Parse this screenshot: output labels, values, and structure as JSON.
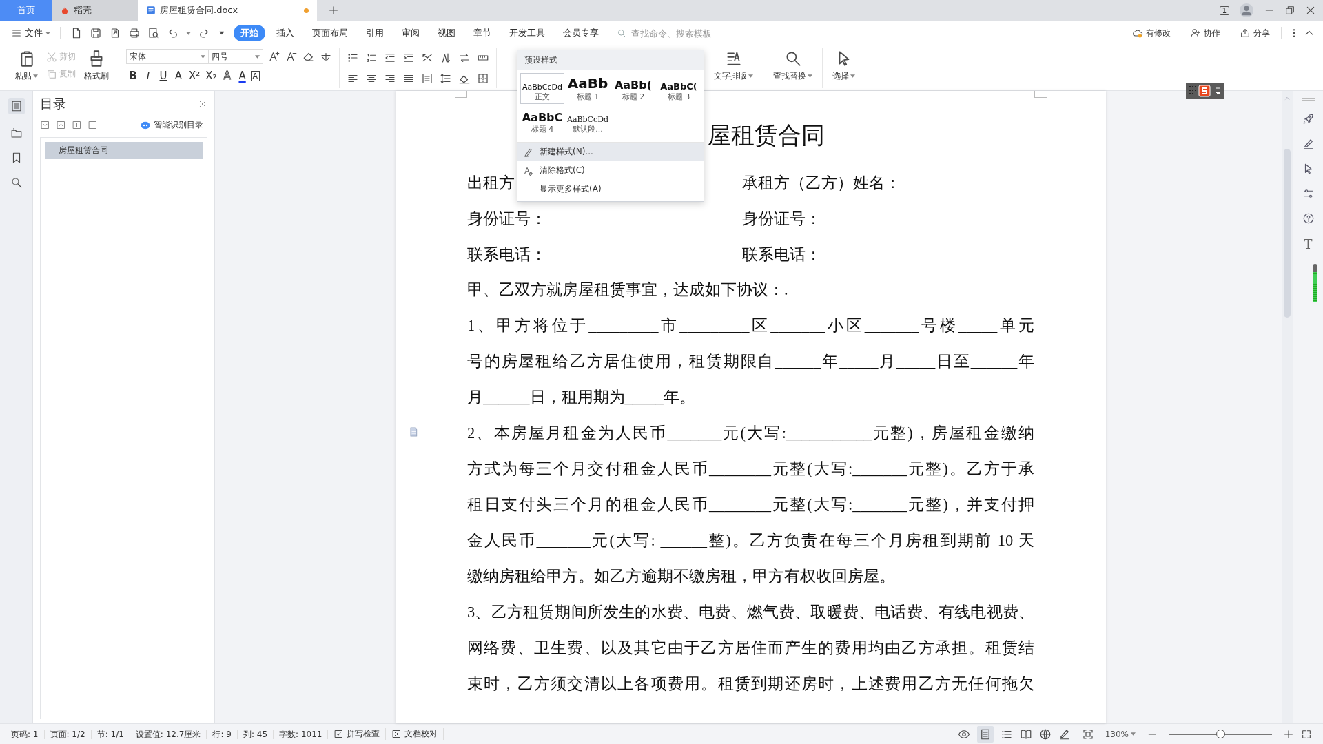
{
  "title_bar": {
    "tabs": [
      {
        "label": "首页",
        "kind": "home",
        "selected": false,
        "modified": false
      },
      {
        "label": "稻壳",
        "kind": "app",
        "selected": false,
        "modified": false
      },
      {
        "label": "房屋租赁合同.docx",
        "kind": "doc",
        "selected": true,
        "modified": true
      }
    ],
    "window_count": "1"
  },
  "menu_bar": {
    "file": "文件",
    "tabs": [
      {
        "label": "开始",
        "selected": true
      },
      {
        "label": "插入",
        "selected": false
      },
      {
        "label": "页面布局",
        "selected": false
      },
      {
        "label": "引用",
        "selected": false
      },
      {
        "label": "审阅",
        "selected": false
      },
      {
        "label": "视图",
        "selected": false
      },
      {
        "label": "章节",
        "selected": false
      },
      {
        "label": "开发工具",
        "selected": false
      },
      {
        "label": "会员专享",
        "selected": false
      }
    ],
    "search": {
      "placeholder": "查找命令、搜索模板"
    },
    "actions": [
      "有修改",
      "协作",
      "分享"
    ]
  },
  "ribbon": {
    "paste": "粘贴",
    "cut": {
      "label": "剪切",
      "disabled": true
    },
    "copy": {
      "label": "复制",
      "disabled": true
    },
    "format_painter": "格式刷",
    "font": {
      "value": "宋体"
    },
    "font_size": {
      "value": "四号"
    },
    "format_buttons": [
      {
        "label": "B",
        "kind": "bold"
      },
      {
        "label": "I",
        "kind": "italic"
      },
      {
        "label": "U",
        "kind": "underline"
      },
      {
        "label": "A",
        "kind": "strike"
      },
      {
        "label": "X²",
        "kind": "plain"
      },
      {
        "label": "X₂",
        "kind": "plain"
      },
      {
        "label": "A",
        "kind": "outline"
      },
      {
        "label": "A",
        "kind": "color"
      },
      {
        "label": "A",
        "kind": "boxed"
      }
    ],
    "tools": [
      "文字排版",
      "查找替换",
      "选择"
    ]
  },
  "styles_menu": {
    "header": "预设样式",
    "styles": [
      {
        "sample": "AaBbCcDd",
        "label": "正文",
        "kind": "body",
        "selected": true
      },
      {
        "sample": "AaBb",
        "label": "标题 1",
        "kind": "h1",
        "selected": false
      },
      {
        "sample": "AaBb(",
        "label": "标题 2",
        "kind": "h2",
        "selected": false
      },
      {
        "sample": "AaBbC(",
        "label": "标题 3",
        "kind": "h3",
        "selected": false
      },
      {
        "sample": "AaBbC",
        "label": "标题 4",
        "kind": "h4",
        "selected": false
      },
      {
        "sample": "AaBbCcDd",
        "label": "默认段...",
        "kind": "default",
        "selected": false
      }
    ],
    "items": [
      {
        "label": "新建样式(N)...",
        "selected": true
      },
      {
        "label": "清除格式(C)",
        "selected": false
      },
      {
        "label": "显示更多样式(A)",
        "selected": false
      }
    ]
  },
  "navigation": {
    "title": "目录",
    "smart_toc": "智能识别目录",
    "items": [
      {
        "label": "房屋租赁合同",
        "selected": true
      }
    ]
  },
  "document": {
    "title": "屋租赁合同",
    "parties": [
      {
        "left": "出租方",
        "right": "承租方（乙方）姓名："
      },
      {
        "left": "身份证号：",
        "right": "身份证号："
      },
      {
        "left": "联系电话：",
        "right": "联系电话："
      }
    ],
    "lines": [
      {
        "text": "甲、乙双方就房屋租赁事宜，达成如下协议：.",
        "kind": "end",
        "note": false
      },
      {
        "text": "1、甲方将位于_________市_________区_______小区_______号楼_____单元",
        "kind": "full",
        "note": false
      },
      {
        "text": "号的房屋租给乙方居住使用，租赁期限自______年_____月_____日至______年",
        "kind": "full",
        "note": false
      },
      {
        "text": "月______日，租用期为_____年。",
        "kind": "end",
        "note": false
      },
      {
        "text": "2、本房屋月租金为人民币_______元(大写:___________元整)，房屋租金缴纳",
        "kind": "full",
        "note": true
      },
      {
        "text": "方式为每三个月交付租金人民币________元整(大写:_______元整)。乙方于承",
        "kind": "full",
        "note": false
      },
      {
        "text": "租日支付头三个月的租金人民币________元整(大写:_______元整)，并支付押",
        "kind": "full",
        "note": false
      },
      {
        "text": "金人民币_______元(大写: ______整)。乙方负责在每三个月房租到期前 10 天",
        "kind": "full",
        "note": false
      },
      {
        "text": "缴纳房租给甲方。如乙方逾期不缴房租，甲方有权收回房屋。",
        "kind": "end",
        "note": false
      },
      {
        "text": "3、乙方租赁期间所发生的水费、电费、燃气费、取暖费、电话费、有线电视费、",
        "kind": "full",
        "note": false
      },
      {
        "text": "网络费、卫生费、以及其它由于乙方居住而产生的费用均由乙方承担。租赁结",
        "kind": "full",
        "note": false
      },
      {
        "text": "束时，乙方须交清以上各项费用。租赁到期还房时，上述费用乙方无任何拖欠",
        "kind": "full",
        "note": false
      }
    ]
  },
  "right_rail": {
    "text_tool": "T"
  },
  "status_bar": {
    "items": [
      "页码: 1",
      "页面: 1/2",
      "节: 1/1",
      "设置值: 12.7厘米",
      "行: 9",
      "列: 45",
      "字数: 1011"
    ],
    "checks": [
      "拼写检查",
      "文档校对"
    ],
    "zoom": "130%",
    "zoom_slider": {
      "level": 0.5
    }
  }
}
